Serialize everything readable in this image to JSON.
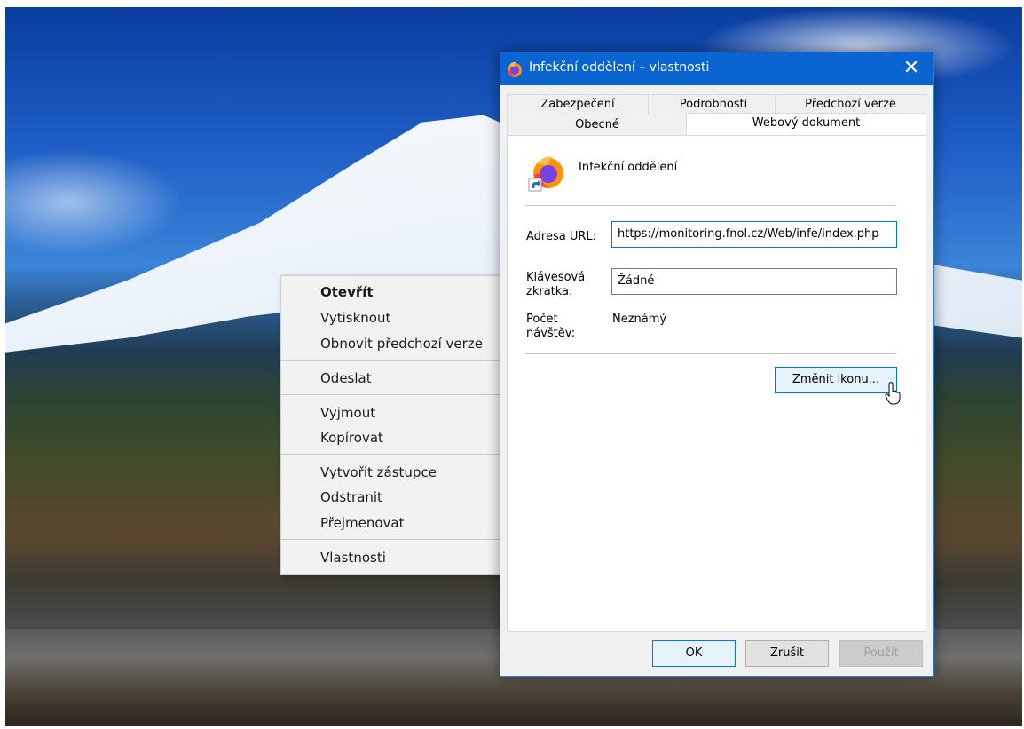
{
  "context_menu": {
    "items": [
      {
        "label": "Otevřít"
      },
      {
        "label": "Vytisknout"
      },
      {
        "label": "Obnovit předchozí verze"
      },
      {
        "label": "Odeslat"
      },
      {
        "label": "Vyjmout"
      },
      {
        "label": "Kopírovat"
      },
      {
        "label": "Vytvořit zástupce"
      },
      {
        "label": "Odstranit"
      },
      {
        "label": "Přejmenovat"
      },
      {
        "label": "Vlastnosti"
      }
    ]
  },
  "dialog": {
    "title": "Infekční oddělení – vlastnosti",
    "close_glyph": "✕",
    "icon": "firefox-icon",
    "tabs_back": [
      "Zabezpečení",
      "Podrobnosti",
      "Předchozí verze"
    ],
    "tabs_front": [
      "Obecné",
      "Webový dokument"
    ],
    "selected_tab": "Webový dokument",
    "name": "Infekční oddělení",
    "url_label": "Adresa URL:",
    "url_value": "https://monitoring.fnol.cz/Web/infe/index.php",
    "shortcut_label_1": "Klávesová",
    "shortcut_label_2": "zkratka:",
    "shortcut_value": "Žádné",
    "visits_label_1": "Počet",
    "visits_label_2": "návštěv:",
    "visits_value": "Neznámý",
    "change_icon_button": "Změnit ikonu...",
    "ok_button": "OK",
    "cancel_button": "Zrušit",
    "apply_button": "Použít"
  },
  "colors": {
    "titlebar": "#0a64d2",
    "accent": "#0078d7"
  }
}
